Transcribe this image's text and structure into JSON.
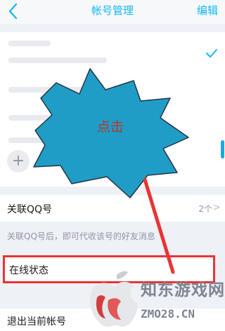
{
  "nav": {
    "title": "帐号管理",
    "edit_label": "编辑",
    "back_icon": "back-chevron-icon"
  },
  "accounts": {
    "add_label": "添加"
  },
  "qq_link": {
    "label": "关联QQ号",
    "value": "2个",
    "arrow": ">"
  },
  "hint": "关联QQ号后，即可代收该号的好友消息",
  "online_status": {
    "label": "在线状态"
  },
  "logout": {
    "label": "退出当前帐号"
  },
  "annotation": {
    "label": "点击",
    "color": "#1f9dc7",
    "highlight_color": "#ea3333"
  },
  "watermark": {
    "cn_text": "知东游戏网",
    "url_text": "ZMO28.CN"
  },
  "colors": {
    "accent": "#12b7f5",
    "background": "#eef1f6",
    "card": "#ffffff"
  }
}
